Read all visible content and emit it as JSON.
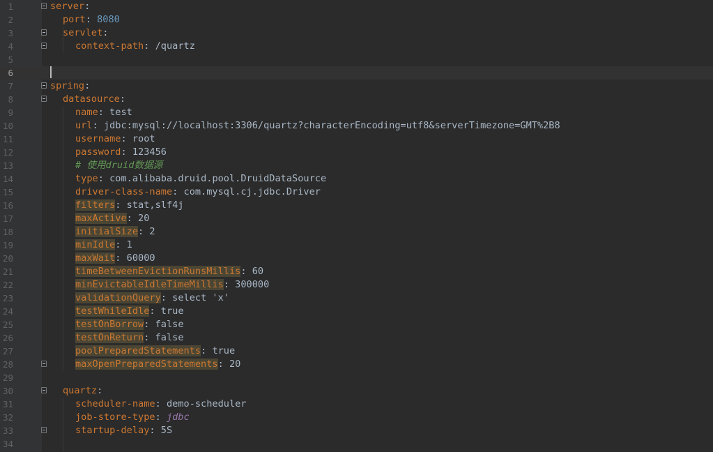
{
  "editor": {
    "language": "yaml",
    "current_line": 6,
    "colors": {
      "background": "#2b2b2b",
      "gutter": "#313335",
      "key": "#cc7832",
      "number": "#6897bb",
      "text": "#a9b7c6",
      "comment": "#629755",
      "constant": "#9876aa",
      "highlight": "#4b4634"
    },
    "lines": [
      {
        "n": "1",
        "indent": 0,
        "key": "server",
        "sep": ":",
        "value": "",
        "fold": "open"
      },
      {
        "n": "2",
        "indent": 1,
        "key": "port",
        "sep": ": ",
        "value": "8080",
        "vtype": "num"
      },
      {
        "n": "3",
        "indent": 1,
        "key": "servlet",
        "sep": ":",
        "value": "",
        "fold": "open"
      },
      {
        "n": "4",
        "indent": 2,
        "key": "context-path",
        "sep": ": ",
        "value": "/quartz",
        "fold": "end"
      },
      {
        "n": "5",
        "indent": 0,
        "key": "",
        "sep": "",
        "value": ""
      },
      {
        "n": "6",
        "indent": 0,
        "key": "",
        "sep": "",
        "value": "",
        "current": true
      },
      {
        "n": "7",
        "indent": 0,
        "key": "spring",
        "sep": ":",
        "value": "",
        "fold": "open"
      },
      {
        "n": "8",
        "indent": 1,
        "key": "datasource",
        "sep": ":",
        "value": "",
        "fold": "open"
      },
      {
        "n": "9",
        "indent": 2,
        "key": "name",
        "sep": ": ",
        "value": "test"
      },
      {
        "n": "10",
        "indent": 2,
        "key": "url",
        "sep": ": ",
        "value": "jdbc:mysql://localhost:3306/quartz?characterEncoding=utf8&serverTimezone=GMT%2B8"
      },
      {
        "n": "11",
        "indent": 2,
        "key": "username",
        "sep": ": ",
        "value": "root"
      },
      {
        "n": "12",
        "indent": 2,
        "key": "password",
        "sep": ": ",
        "value": "123456"
      },
      {
        "n": "13",
        "indent": 2,
        "key": "",
        "sep": "",
        "value": "",
        "comment": "# 使用druid数据源"
      },
      {
        "n": "14",
        "indent": 2,
        "key": "type",
        "sep": ": ",
        "value": "com.alibaba.druid.pool.DruidDataSource"
      },
      {
        "n": "15",
        "indent": 2,
        "key": "driver-class-name",
        "sep": ": ",
        "value": "com.mysql.cj.jdbc.Driver"
      },
      {
        "n": "16",
        "indent": 2,
        "key": "filters",
        "sep": ": ",
        "value": "stat,slf4j",
        "hl": true
      },
      {
        "n": "17",
        "indent": 2,
        "key": "maxActive",
        "sep": ": ",
        "value": "20",
        "hl": true
      },
      {
        "n": "18",
        "indent": 2,
        "key": "initialSize",
        "sep": ": ",
        "value": "2",
        "hl": true
      },
      {
        "n": "19",
        "indent": 2,
        "key": "minIdle",
        "sep": ": ",
        "value": "1",
        "hl": true
      },
      {
        "n": "20",
        "indent": 2,
        "key": "maxWait",
        "sep": ": ",
        "value": "60000",
        "hl": true
      },
      {
        "n": "21",
        "indent": 2,
        "key": "timeBetweenEvictionRunsMillis",
        "sep": ": ",
        "value": "60",
        "hl": true
      },
      {
        "n": "22",
        "indent": 2,
        "key": "minEvictableIdleTimeMillis",
        "sep": ": ",
        "value": "300000",
        "hl": true
      },
      {
        "n": "23",
        "indent": 2,
        "key": "validationQuery",
        "sep": ": ",
        "value": "select 'x'",
        "hl": true
      },
      {
        "n": "24",
        "indent": 2,
        "key": "testWhileIdle",
        "sep": ": ",
        "value": "true",
        "hl": true
      },
      {
        "n": "25",
        "indent": 2,
        "key": "testOnBorrow",
        "sep": ": ",
        "value": "false",
        "hl": true
      },
      {
        "n": "26",
        "indent": 2,
        "key": "testOnReturn",
        "sep": ": ",
        "value": "false",
        "hl": true
      },
      {
        "n": "27",
        "indent": 2,
        "key": "poolPreparedStatements",
        "sep": ": ",
        "value": "true",
        "hl": true
      },
      {
        "n": "28",
        "indent": 2,
        "key": "maxOpenPreparedStatements",
        "sep": ": ",
        "value": "20",
        "hl": true,
        "fold": "end"
      },
      {
        "n": "29",
        "indent": 0,
        "key": "",
        "sep": "",
        "value": ""
      },
      {
        "n": "30",
        "indent": 1,
        "key": "quartz",
        "sep": ":",
        "value": "",
        "fold": "open"
      },
      {
        "n": "31",
        "indent": 2,
        "key": "scheduler-name",
        "sep": ": ",
        "value": "demo-scheduler"
      },
      {
        "n": "32",
        "indent": 2,
        "key": "job-store-type",
        "sep": ": ",
        "value": "jdbc",
        "vtype": "italic"
      },
      {
        "n": "33",
        "indent": 2,
        "key": "startup-delay",
        "sep": ": ",
        "value": "5S",
        "fold": "end"
      },
      {
        "n": "34",
        "indent": 0,
        "key": "",
        "sep": "",
        "value": ""
      }
    ]
  }
}
